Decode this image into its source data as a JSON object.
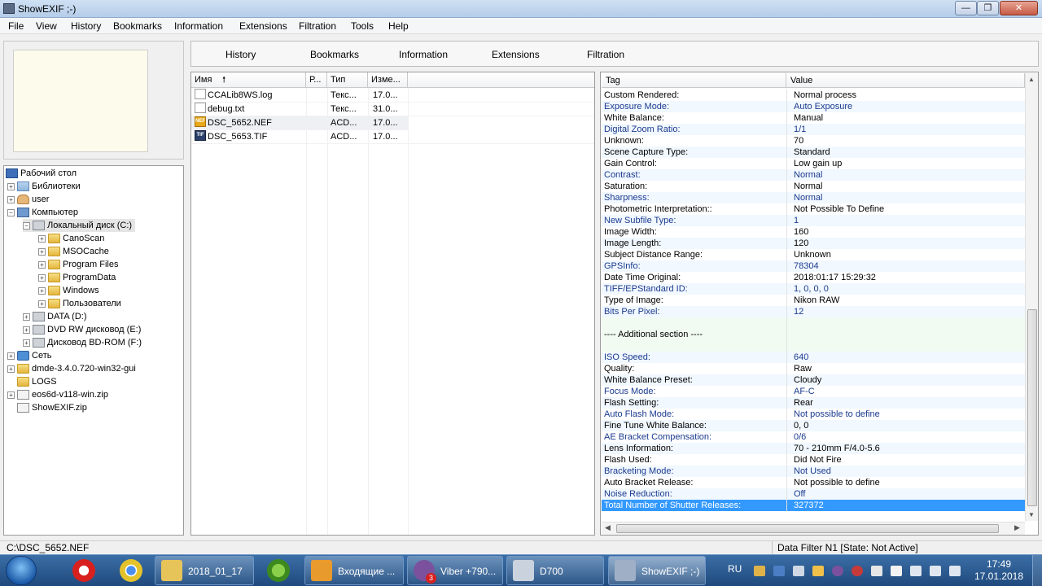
{
  "window": {
    "title": "ShowEXIF ;-)",
    "min_label": "—",
    "max_label": "❐",
    "close_label": "✕"
  },
  "menu": [
    "File",
    "View",
    "History",
    "Bookmarks",
    "Information",
    "Extensions",
    "Filtration",
    "Tools",
    "Help"
  ],
  "tabs": [
    "History",
    "Bookmarks",
    "Information",
    "Extensions",
    "Filtration"
  ],
  "tree": [
    {
      "label": "Рабочий стол",
      "icon": "desktop-icon"
    },
    {
      "label": "Библиотеки",
      "icon": "libraries-icon"
    },
    {
      "label": "user",
      "icon": "user-icon"
    },
    {
      "label": "Компьютер",
      "icon": "computer-icon"
    },
    {
      "label": "Локальный диск (C:)",
      "icon": "drive-icon"
    },
    {
      "label": "CanoScan",
      "icon": "folder-icon"
    },
    {
      "label": "MSOCache",
      "icon": "folder-icon"
    },
    {
      "label": "Program Files",
      "icon": "folder-icon"
    },
    {
      "label": "ProgramData",
      "icon": "folder-icon"
    },
    {
      "label": "Windows",
      "icon": "folder-icon"
    },
    {
      "label": "Пользователи",
      "icon": "folder-icon"
    },
    {
      "label": "DATA (D:)",
      "icon": "drive-icon"
    },
    {
      "label": "DVD RW дисковод (E:)",
      "icon": "dvd-drive-icon"
    },
    {
      "label": "Дисковод BD-ROM (F:)",
      "icon": "bd-drive-icon"
    },
    {
      "label": "Сеть",
      "icon": "network-icon"
    },
    {
      "label": "dmde-3.4.0.720-win32-gui",
      "icon": "folder-icon"
    },
    {
      "label": "LOGS",
      "icon": "folder-icon"
    },
    {
      "label": "eos6d-v118-win.zip",
      "icon": "zip-icon"
    },
    {
      "label": "ShowEXIF.zip",
      "icon": "zip-icon"
    }
  ],
  "filelist": {
    "columns": [
      "Имя",
      "Р...",
      "Тип",
      "Изме..."
    ],
    "sort_arrow": "🠕",
    "rows": [
      {
        "name": "CCALib8WS.log",
        "type": "Текс...",
        "modified": "17.0...",
        "icon": "text-file-icon",
        "badge": ""
      },
      {
        "name": "debug.txt",
        "type": "Текс...",
        "modified": "31.0...",
        "icon": "text-file-icon",
        "badge": ""
      },
      {
        "name": "DSC_5652.NEF",
        "type": "ACD...",
        "modified": "17.0...",
        "icon": "nef-file-icon",
        "badge": "NEF"
      },
      {
        "name": "DSC_5653.TIF",
        "type": "ACD...",
        "modified": "17.0...",
        "icon": "tif-file-icon",
        "badge": "TIF"
      }
    ]
  },
  "exif": {
    "columns": [
      "Tag",
      "Value"
    ],
    "rows": [
      {
        "tag": "Custom Rendered:",
        "value": "Normal process"
      },
      {
        "tag": "Exposure Mode:",
        "value": "Auto Exposure"
      },
      {
        "tag": "White Balance:",
        "value": "Manual"
      },
      {
        "tag": "Digital Zoom Ratio:",
        "value": "1/1"
      },
      {
        "tag": "Unknown:",
        "value": "70"
      },
      {
        "tag": "Scene Capture Type:",
        "value": "Standard"
      },
      {
        "tag": "Gain Control:",
        "value": "Low gain up"
      },
      {
        "tag": "Contrast:",
        "value": "Normal"
      },
      {
        "tag": "Saturation:",
        "value": "Normal"
      },
      {
        "tag": "Sharpness:",
        "value": "Normal"
      },
      {
        "tag": "Photometric Interpretation::",
        "value": "Not Possible To Define"
      },
      {
        "tag": "New Subfile Type:",
        "value": "1"
      },
      {
        "tag": "Image Width:",
        "value": "160"
      },
      {
        "tag": "Image Length:",
        "value": "120"
      },
      {
        "tag": "Subject Distance Range:",
        "value": "Unknown"
      },
      {
        "tag": "GPSInfo:",
        "value": "78304"
      },
      {
        "tag": "Date Time Original:",
        "value": "2018:01:17 15:29:32"
      },
      {
        "tag": "TIFF/EPStandard ID:",
        "value": "1, 0, 0, 0"
      },
      {
        "tag": "Type of Image:",
        "value": "Nikon RAW"
      },
      {
        "tag": "Bits Per Pixel:",
        "value": "12"
      },
      {
        "tag": "",
        "value": ""
      },
      {
        "tag": "---- Additional section ----",
        "value": ""
      },
      {
        "tag": "",
        "value": ""
      },
      {
        "tag": "ISO Speed:",
        "value": "640"
      },
      {
        "tag": "Quality:",
        "value": "Raw"
      },
      {
        "tag": "White Balance Preset:",
        "value": "Cloudy"
      },
      {
        "tag": "Focus Mode:",
        "value": "AF-C"
      },
      {
        "tag": "Flash Setting:",
        "value": "Rear"
      },
      {
        "tag": "Auto Flash Mode:",
        "value": "Not possible to define"
      },
      {
        "tag": "Fine Tune White Balance:",
        "value": "0, 0"
      },
      {
        "tag": "AE Bracket Compensation:",
        "value": "0/6"
      },
      {
        "tag": "Lens Information:",
        "value": "70 - 210mm  F/4.0-5.6"
      },
      {
        "tag": "Flash Used:",
        "value": "Did Not Fire"
      },
      {
        "tag": "Bracketing Mode:",
        "value": "Not Used"
      },
      {
        "tag": "Auto Bracket Release:",
        "value": "Not possible to define"
      },
      {
        "tag": "Noise Reduction:",
        "value": "Off"
      },
      {
        "tag": "Total Number of Shutter Releases:",
        "value": "327372"
      }
    ]
  },
  "status": {
    "path": "C:\\DSC_5652.NEF",
    "filter": "Data Filter N1 [State: Not Active]"
  },
  "taskbar": {
    "tasks": [
      {
        "label": "2018_01_17",
        "icon": "explorer-folder-icon"
      },
      {
        "label": "Входящие ...",
        "icon": "outlook-icon"
      },
      {
        "label": "Viber +790...",
        "icon": "viber-icon"
      },
      {
        "label": "D700",
        "icon": "camera-app-icon"
      },
      {
        "label": "ShowEXIF ;-)",
        "icon": "showexif-icon"
      }
    ],
    "viber_badge": "3",
    "lang": "RU",
    "time": "17:49",
    "date": "17.01.2018"
  },
  "colors": {
    "selection": "#3399ff",
    "titlebar": "#b5cde9",
    "taskbar": "#1f4a7d"
  }
}
